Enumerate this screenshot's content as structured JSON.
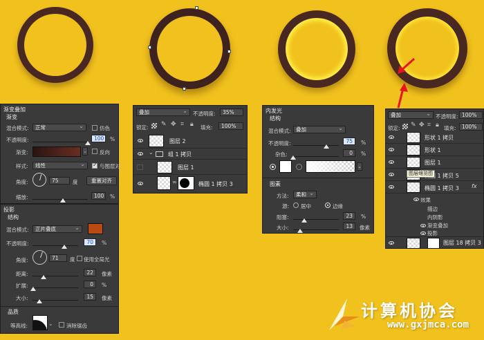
{
  "panel_gradient": {
    "title": "渐变叠加",
    "section": "渐变",
    "blend_label": "混合模式:",
    "blend_value": "正常",
    "dither_label": "仿色",
    "opacity_label": "不透明度:",
    "opacity_value": "100",
    "opacity_unit": "%",
    "opacity_level": 1.0,
    "gradient_label": "渐变:",
    "reverse_label": "反向",
    "style_label": "样式:",
    "style_value": "线性",
    "align_label": "与图层对",
    "angle_label": "角度:",
    "angle_value": "75",
    "angle_unit": "度",
    "reset_button": "重置对齐",
    "scale_label": "缩放:",
    "scale_value": "100",
    "scale_unit": "%"
  },
  "panel_shadow": {
    "title": "投影",
    "section": "结构",
    "blend_label": "混合模式:",
    "blend_value": "正片叠底",
    "color": "#b94a12",
    "opacity_label": "不透明度:",
    "opacity_value": "70",
    "opacity_unit": "%",
    "angle_label": "角度:",
    "angle_value": "71",
    "angle_unit": "度",
    "global_light_label": "使用全局光",
    "distance_label": "距离:",
    "distance_value": "22",
    "distance_unit": "像素",
    "spread_label": "扩展:",
    "spread_value": "0",
    "spread_unit": "%",
    "size_label": "大小:",
    "size_value": "15",
    "size_unit": "像素",
    "quality_title": "品质",
    "contour_label": "等高线:",
    "antialias_label": "消除锯齿"
  },
  "panel_layers1": {
    "blend_value": "叠加",
    "opacity_label": "不透明度:",
    "opacity_value": "35%",
    "lock_label": "锁定:",
    "fill_label": "填充:",
    "fill_value": "100%",
    "layers": [
      {
        "name": "图层 2"
      },
      {
        "name": "组 1 拷贝"
      },
      {
        "name": "图层 1"
      },
      {
        "name": "椭圆 1 拷贝 3"
      }
    ]
  },
  "panel_innerglow": {
    "title": "内发光",
    "section": "结构",
    "blend_label": "混合模式:",
    "blend_value": "叠加",
    "opacity_label": "不透明度:",
    "opacity_value": "75",
    "opacity_unit": "%",
    "noise_label": "杂色:",
    "noise_value": "0",
    "noise_unit": "%",
    "elements_title": "图素",
    "method_label": "方法:",
    "method_value": "柔和",
    "source_label": "源:",
    "source_center": "居中",
    "source_edge": "边缘",
    "choke_label": "阻塞:",
    "choke_value": "23",
    "choke_unit": "%",
    "size_label": "大小:",
    "size_value": "13",
    "size_unit": "像素"
  },
  "panel_layers2": {
    "blend_value": "叠加",
    "opacity_label": "不透明度:",
    "opacity_value": "100%",
    "lock_label": "锁定:",
    "fill_label": "填充:",
    "fill_value": "100%",
    "tooltip": "图层缩览图",
    "layers": [
      {
        "name": "形状 1 拷贝"
      },
      {
        "name": "形状 1"
      },
      {
        "name": "图层 1"
      },
      {
        "name": "椭圆 1 拷贝 5"
      },
      {
        "name": "椭圆 1 拷贝 3"
      }
    ],
    "fx_label": "fx",
    "effects_label": "效果",
    "effects": [
      "描边",
      "内阴影",
      "渐变叠加",
      "投影"
    ],
    "last_layer": "图层 18 拷贝 3"
  },
  "watermark": {
    "title": "计算机协会",
    "url": "www.gxjmca.com"
  }
}
